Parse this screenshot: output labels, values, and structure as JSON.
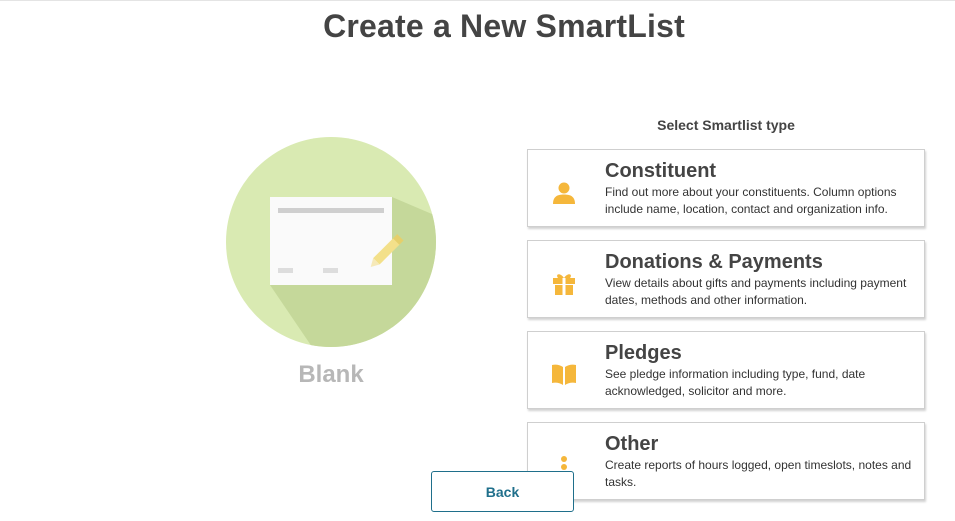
{
  "page": {
    "title": "Create a New SmartList"
  },
  "template": {
    "label": "Blank",
    "icon": "blank-document-pencil-icon"
  },
  "type_selector": {
    "label": "Select Smartlist type",
    "types": [
      {
        "title": "Constituent",
        "description": "Find out more about your constituents. Column options include name, location, contact and organization info.",
        "icon": "person-icon"
      },
      {
        "title": "Donations & Payments",
        "description": "View details about gifts and payments including payment dates, methods and other information.",
        "icon": "gift-icon"
      },
      {
        "title": "Pledges",
        "description": "See pledge information including type, fund, date acknowledged, solicitor and more.",
        "icon": "book-icon"
      },
      {
        "title": "Other",
        "description": "Create reports of hours logged, open timeslots, notes and tasks.",
        "icon": "more-vertical-icon"
      }
    ]
  },
  "footer": {
    "back_label": "Back"
  },
  "colors": {
    "accent": "#1f6f8b",
    "icon": "#f5b73b",
    "circle": "#d9eab2",
    "circle_shadow": "#c5d89a"
  }
}
